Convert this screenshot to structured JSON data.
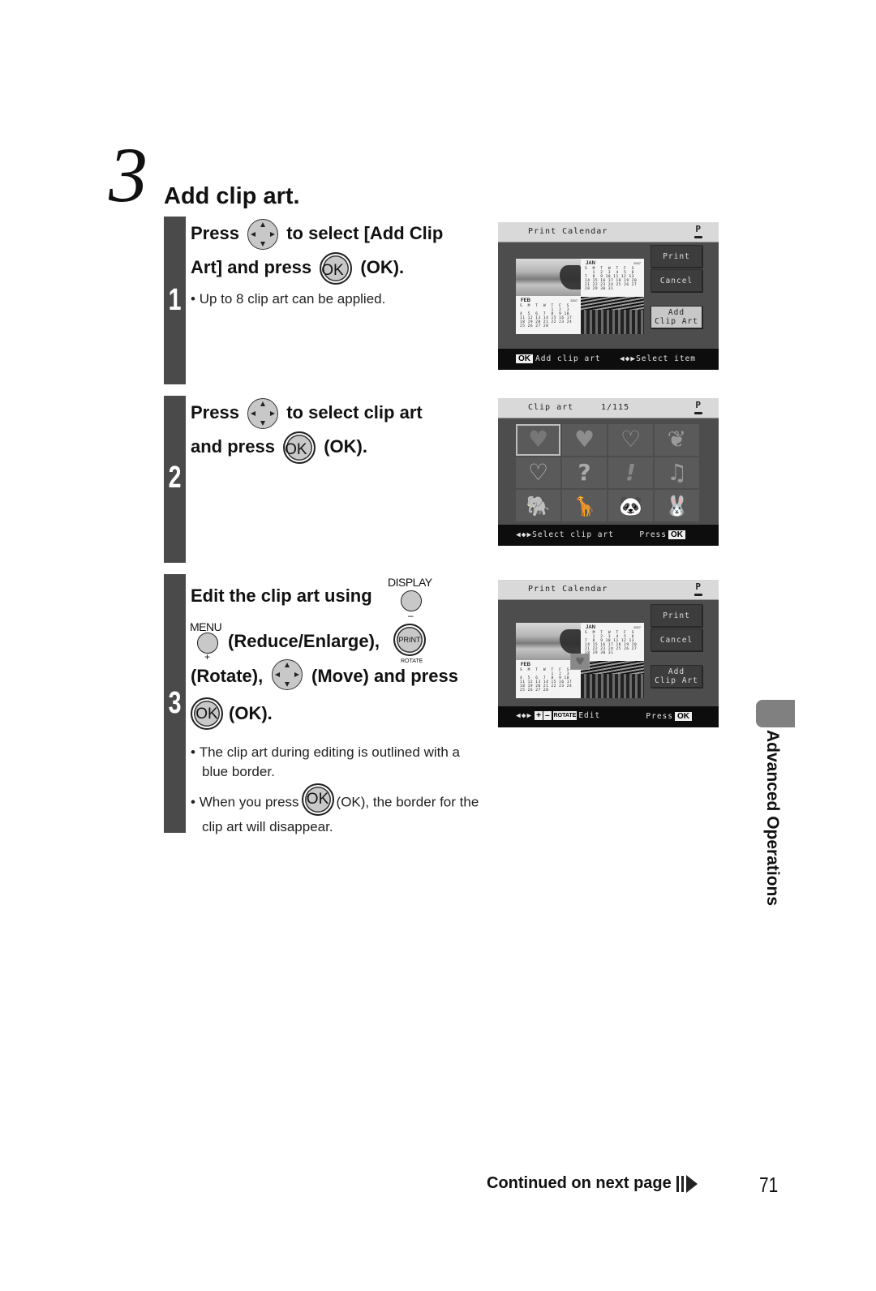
{
  "section": {
    "number": "3",
    "title": "Add clip art."
  },
  "steps": [
    {
      "number": "1",
      "instruction": {
        "part1": "Press",
        "part2": "to select [Add Clip",
        "part3": "Art] and press",
        "ok_icon_label": "OK",
        "part4": "(OK)."
      },
      "notes": [
        "Up to 8 clip art can be applied."
      ],
      "screen": {
        "title": "Print Calendar",
        "printer_icon_label": "P",
        "buttons": [
          "Print",
          "Cancel",
          "Add\nClip Art"
        ],
        "selected_button": "Add Clip Art",
        "calendar": {
          "month1": "JAN",
          "year1": "2007",
          "grid1": "S  M  T  W  T  F  S\n   1  2  3  4  5  6\n7  8  9 10 11 12 13\n14 15 16 17 18 19 20\n21 22 23 24 25 26 27\n28 29 30 31",
          "month2": "FEB",
          "year2": "2007",
          "grid2": "S  M  T  W  T  F  S\n            1  2  3\n4  5  6  7  8  9 10\n11 12 13 14 15 16 17\n18 19 20 21 22 23 24\n25 26 27 28"
        },
        "footer_left_chip": "OK",
        "footer_left": "Add clip art",
        "footer_right_arrows": "◀◆▶",
        "footer_right": "Select item"
      }
    },
    {
      "number": "2",
      "instruction": {
        "part1": "Press",
        "part2": "to select clip art",
        "part3": "and press",
        "ok_icon_label": "OK",
        "part4": "(OK)."
      },
      "screen": {
        "title": "Clip art",
        "counter": "1/115",
        "printer_icon_label": "P",
        "clip_items": [
          {
            "name": "heart-glossy",
            "glyph": "♥"
          },
          {
            "name": "heart-solid",
            "glyph": "♥"
          },
          {
            "name": "heart-outline",
            "glyph": "♡"
          },
          {
            "name": "hearts-three",
            "glyph": "❦"
          },
          {
            "name": "heart-dotted",
            "glyph": "♡"
          },
          {
            "name": "question-mark",
            "glyph": "?"
          },
          {
            "name": "exclamation-mark",
            "glyph": "!"
          },
          {
            "name": "music-notes",
            "glyph": "♫"
          },
          {
            "name": "elephant",
            "glyph": "🐘"
          },
          {
            "name": "giraffe",
            "glyph": "🦒"
          },
          {
            "name": "panda",
            "glyph": "🐼"
          },
          {
            "name": "rabbit",
            "glyph": "🐰"
          }
        ],
        "footer_left_arrows": "◀◆▶",
        "footer_left": "Select clip art",
        "footer_right": "Press",
        "footer_right_chip": "OK"
      }
    },
    {
      "number": "3",
      "instruction": {
        "part1": "Edit the clip art using",
        "display_label": "DISPLAY",
        "minus_label": "–",
        "menu_label": "MENU",
        "plus_label": "+",
        "part2": "(Reduce/Enlarge),",
        "print_label": "PRINT",
        "rotate_label": "ROTATE",
        "part3": "(Rotate),",
        "part4": "(Move) and press",
        "ok_icon_label": "OK",
        "part5": "(OK)."
      },
      "notes": [
        "The clip art during editing is outlined with a blue border.",
        {
          "before": "When you press",
          "ok_icon_label": "OK",
          "after": "(OK), the border for the clip art will disappear."
        }
      ],
      "screen": {
        "title": "Print Calendar",
        "printer_icon_label": "P",
        "buttons": [
          "Print",
          "Cancel",
          "Add\nClip Art"
        ],
        "footer_left_arrows": "◀◆▶",
        "footer_left_plus": "+",
        "footer_left_minus": "–",
        "footer_left_rotate": "ROTATE",
        "footer_left": "Edit",
        "footer_right": "Press",
        "footer_right_chip": "OK"
      }
    }
  ],
  "side_tab": {
    "label": "Advanced Operations"
  },
  "footer": {
    "continued": "Continued on next page",
    "page_number": "71"
  },
  "colors": {
    "step_bar": "#4a4a4a",
    "side_tab": "#808080",
    "lcd_bg": "#4d4d4d",
    "lcd_header": "#d9d9d9",
    "lcd_footer": "#0d0d0d"
  }
}
